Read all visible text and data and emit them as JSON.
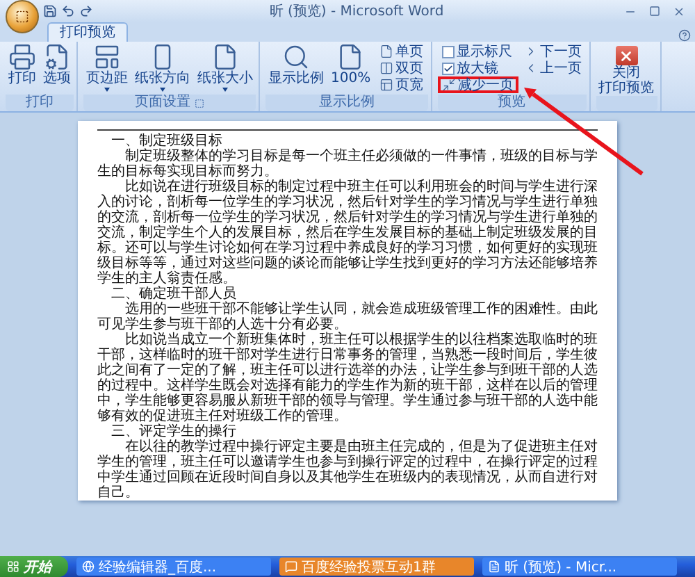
{
  "window": {
    "title": "昕 (预览) - Microsoft Word"
  },
  "tabs": [
    {
      "label": "打印预览",
      "selected": true
    }
  ],
  "ribbon": {
    "groups": [
      {
        "label": "打印",
        "launcher": false,
        "items": [
          {
            "kind": "large",
            "label": "打印",
            "dropdown": false
          },
          {
            "kind": "large",
            "label": "选项",
            "dropdown": false
          }
        ]
      },
      {
        "label": "页面设置",
        "launcher": true,
        "items": [
          {
            "kind": "large",
            "label": "页边距",
            "dropdown": true
          },
          {
            "kind": "large",
            "label": "纸张方向",
            "dropdown": true
          },
          {
            "kind": "large",
            "label": "纸张大小",
            "dropdown": true
          }
        ]
      },
      {
        "label": "显示比例",
        "launcher": false,
        "items": [
          {
            "kind": "large",
            "label": "显示比例",
            "dropdown": false
          },
          {
            "kind": "large",
            "label": "100%",
            "dropdown": false
          },
          {
            "kind": "stack",
            "entries": [
              {
                "kind": "small",
                "label": "单页",
                "highlighted": false
              },
              {
                "kind": "small",
                "label": "双页",
                "highlighted": false
              },
              {
                "kind": "small",
                "label": "页宽",
                "highlighted": false
              }
            ]
          }
        ]
      },
      {
        "label": "预览",
        "launcher": false,
        "items": [
          {
            "kind": "stack",
            "entries": [
              {
                "kind": "check",
                "label": "显示标尺",
                "checked": false
              },
              {
                "kind": "check",
                "label": "放大镜",
                "checked": true
              },
              {
                "kind": "small",
                "label": "减少一页",
                "highlighted": true
              }
            ]
          },
          {
            "kind": "stack",
            "entries": [
              {
                "kind": "small",
                "label": "下一页",
                "highlighted": false
              },
              {
                "kind": "small",
                "label": "上一页",
                "highlighted": false
              }
            ]
          }
        ]
      },
      {
        "launcher": false,
        "items": [
          {
            "kind": "close",
            "label_lines": [
              "关闭",
              "打印预览"
            ]
          }
        ]
      }
    ]
  },
  "document": {
    "paragraphs": [
      {
        "kind": "heading",
        "text": "一、制定班级目标"
      },
      {
        "kind": "body",
        "text": "制定班级整体的学习目标是每一个班主任必须做的一件事情，班级的目标与学生的目标每实现目标而努力。"
      },
      {
        "kind": "body",
        "text": "比如说在进行班级目标的制定过程中班主任可以利用班会的时间与学生进行深入的讨论，剖析每一位学生的学习状况，然后针对学生的学习情况与学生进行单独的交流，剖析每一位学生的学习状况，然后针对学生的学习情况与学生进行单独的交流，制定学生个人的发展目标，然后在学生发展目标的基础上制定班级发展的目标。还可以与学生讨论如何在学习过程中养成良好的学习习惯，如何更好的实现班级目标等等，通过对这些问题的谈论而能够让学生找到更好的学习方法还能够培养学生的主人翁责任感。"
      },
      {
        "kind": "heading",
        "text": "二、确定班干部人员"
      },
      {
        "kind": "body",
        "text": "选用的一些班干部不能够让学生认同，就会造成班级管理工作的困难性。由此可见学生参与班干部的人选十分有必要。"
      },
      {
        "kind": "body",
        "text": "比如说当成立一个新班集体时，班主任可以根据学生的以往档案选取临时的班干部，这样临时的班干部对学生进行日常事务的管理，当熟悉一段时间后，学生彼此之间有了一定的了解，班主任可以进行选举的办法，让学生参与到班干部的人选的过程中。这样学生既会对选择有能力的学生作为新的班干部，这样在以后的管理中，学生能够更容易服从新班干部的领导与管理。学生通过参与班干部的人选中能够有效的促进班主任对班级工作的管理。"
      },
      {
        "kind": "heading",
        "text": "三、评定学生的操行"
      },
      {
        "kind": "body",
        "text": "在以往的教学过程中操行评定主要是由班主任完成的，但是为了促进班主任对学生的管理，班主任可以邀请学生也参与到操行评定的过程中，在操行评定的过程中学生通过回顾在近段时间自身以及其他学生在班级内的表现情况，从而自进行对自己。"
      }
    ]
  },
  "taskbar": {
    "start": "开始",
    "tasks": [
      {
        "label": "经验编辑器_百度...",
        "highlighted": false
      },
      {
        "label": "百度经验投票互动1群",
        "highlighted": true
      },
      {
        "label": "昕 (预览) - Micr...",
        "highlighted": false
      }
    ]
  }
}
